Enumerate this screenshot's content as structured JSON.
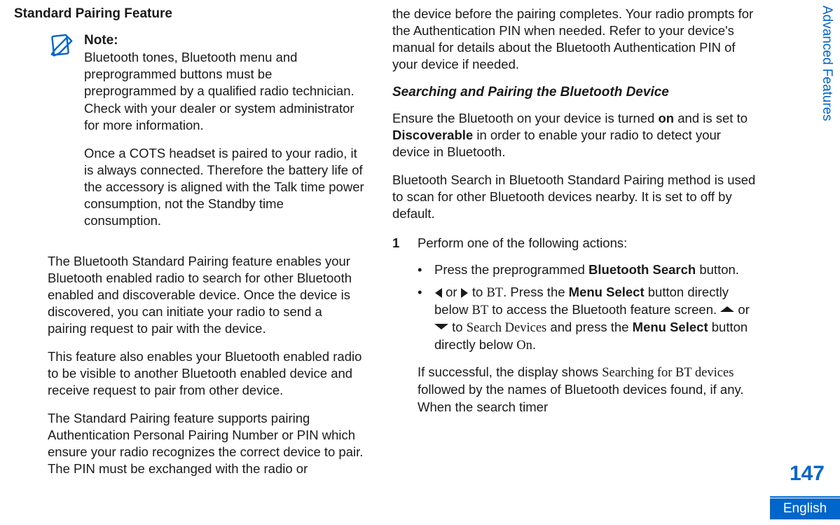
{
  "left": {
    "section_title": "Standard Pairing Feature",
    "note_heading": "Note:",
    "note_p1": "Bluetooth tones, Bluetooth menu and preprogrammed buttons must be preprogrammed by a qualified radio technician. Check with your dealer or system administrator for more information.",
    "note_p2": "Once a COTS headset is paired to your radio, it is always connected. Therefore the battery life of the accessory is aligned with the Talk time power consumption, not the Standby time consumption.",
    "para1": "The Bluetooth Standard Pairing feature enables your Bluetooth enabled radio to search for other Bluetooth enabled and discoverable device. Once the device is discovered, you can initiate your radio to send a pairing request to pair with the device.",
    "para2": "This feature also enables your Bluetooth enabled radio to be visible to another Bluetooth enabled device and receive request to pair from other device.",
    "para3": "The Standard Pairing feature supports pairing Authentication Personal Pairing Number or PIN which ensure your radio recognizes the correct device to pair. The PIN must be exchanged with the radio or"
  },
  "right": {
    "para_top": "the device before the pairing completes. Your radio prompts for the Authentication PIN when needed. Refer to your device's manual for details about the Bluetooth Authentication PIN of your device if needed.",
    "subheading": "Searching and Pairing the Bluetooth Device",
    "ensure_pre": "Ensure the Bluetooth on your device is turned ",
    "ensure_on": "on",
    "ensure_mid": " and is set to ",
    "ensure_disc": "Discoverable",
    "ensure_post": " in order to enable your radio to detect your device in Bluetooth.",
    "bt_search": "Bluetooth Search in Bluetooth Standard Pairing method is used to scan for other Bluetooth devices nearby. It is set to off by default.",
    "step1_num": "1",
    "step1_text": "Perform one of the following actions:",
    "bullet1_pre": "Press the preprogrammed ",
    "bullet1_bold": "Bluetooth Search",
    "bullet1_post": " button.",
    "bullet2_or1": " or ",
    "bullet2_to1": " to ",
    "bullet2_bt1": "BT",
    "bullet2_press": ". Press the ",
    "bullet2_menusel": "Menu Select",
    "bullet2_btn_below": " button directly below ",
    "bullet2_bt2": "BT",
    "bullet2_access": " to access the Bluetooth feature screen. ",
    "bullet2_or2": " or ",
    "bullet2_to2": " to ",
    "bullet2_search": "Search Devices",
    "bullet2_and": " and press the ",
    "bullet2_menusel2": "Menu Select",
    "bullet2_btn_below2": " button directly below ",
    "bullet2_on": "On",
    "bullet2_period": ".",
    "result_pre": "If successful, the display shows ",
    "result_searching": "Searching for BT devices",
    "result_mid": " followed by the names of Bluetooth devices found, if any. When the search timer"
  },
  "side": {
    "tab": "Advanced Features",
    "page_number": "147",
    "language": "English"
  }
}
